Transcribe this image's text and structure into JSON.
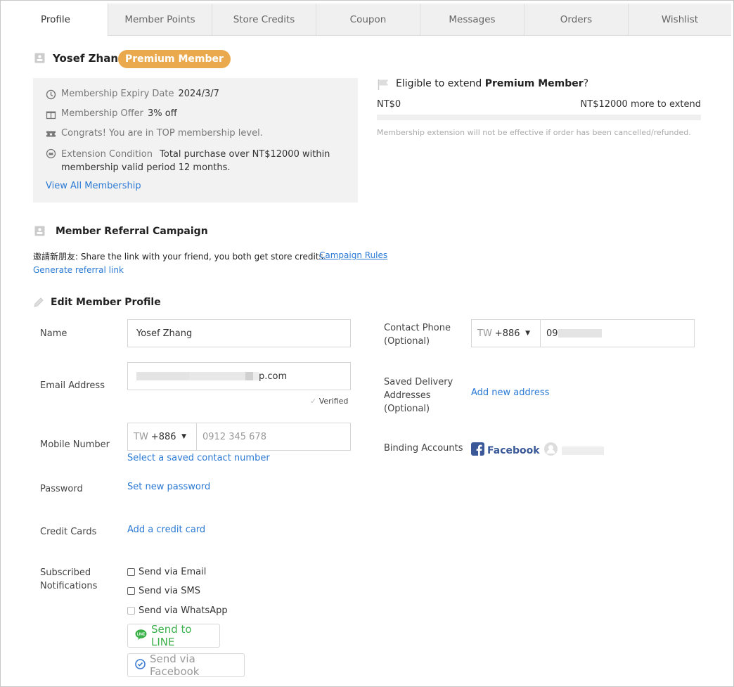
{
  "tabs": [
    "Profile",
    "Member Points",
    "Store Credits",
    "Coupon",
    "Messages",
    "Orders",
    "Wishlist"
  ],
  "user": {
    "name": "Yosef Zhang",
    "badge": "Premium Member"
  },
  "membership": {
    "expiry_label": "Membership Expiry Date",
    "expiry_value": "2024/3/7",
    "offer_label": "Membership Offer",
    "offer_value": "3% off",
    "top_level_text": "Congrats! You are in TOP membership level.",
    "extension_label": "Extension Condition",
    "extension_value_line1": "Total purchase over NT$12000 within",
    "extension_value_line2": "membership valid period 12 months.",
    "view_all_link": "View All Membership"
  },
  "extend": {
    "title_prefix": "Eligible to extend ",
    "title_bold": "Premium Member",
    "title_suffix": "?",
    "current": "NT$0",
    "remaining": "NT$12000 more to extend",
    "progress": 0,
    "note": "Membership extension will not be effective if order has been cancelled/refunded."
  },
  "referral": {
    "title": "Member Referral Campaign",
    "description": "邀請新朋友: Share the link with your friend, you both get store credits.",
    "rules_link": "Campaign Rules",
    "generate_link": "Generate referral link"
  },
  "profile": {
    "title": "Edit Member Profile",
    "name_label": "Name",
    "name_value": "Yosef Zhang",
    "email_label": "Email Address",
    "email_visible_part": "p.com",
    "verified": "Verified",
    "mobile_label": "Mobile Number",
    "mobile_country": "TW",
    "mobile_code": "+886",
    "mobile_placeholder": "0912 345 678",
    "select_saved_contact": "Select a saved contact number",
    "password_label": "Password",
    "set_password": "Set new password",
    "credit_label": "Credit Cards",
    "add_credit": "Add a credit card",
    "notif_label_line1": "Subscribed",
    "notif_label_line2": "Notifications",
    "send_email": "Send via Email",
    "send_sms": "Send via SMS",
    "send_whatsapp": "Send via WhatsApp",
    "send_line": "Send to LINE",
    "send_facebook": "Send via Facebook",
    "contact_label_line1": "Contact Phone",
    "contact_label_line2": "(Optional)",
    "contact_country": "TW",
    "contact_code": "+886",
    "contact_visible_part": "09",
    "delivery_label_line1": "Saved Delivery",
    "delivery_label_line2": "Addresses",
    "delivery_label_line3": "(Optional)",
    "add_address": "Add new address",
    "binding_label": "Binding Accounts",
    "facebook": "Facebook"
  },
  "colors": {
    "accent": "#2b7ad4",
    "badge": "#e9a94c",
    "line": "#3bb14a",
    "facebook": "#3b5998"
  }
}
